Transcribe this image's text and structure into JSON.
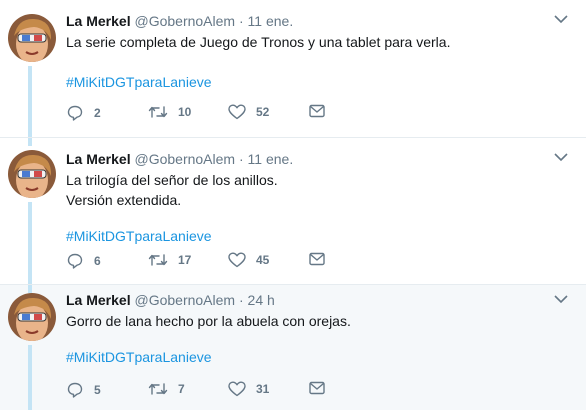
{
  "tweets": [
    {
      "name": "La Merkel",
      "handle": "@GobernoAlem",
      "separator": "·",
      "time": "11 ene.",
      "lines": [
        "La serie completa de Juego de Tronos y una tablet para verla."
      ],
      "hashtag": "#MiKitDGTparaLanieve",
      "replies": "2",
      "retweets": "10",
      "likes": "52"
    },
    {
      "name": "La Merkel",
      "handle": "@GobernoAlem",
      "separator": "·",
      "time": "11 ene.",
      "lines": [
        "La trilogía del señor de los anillos.",
        "Versión extendida."
      ],
      "hashtag": "#MiKitDGTparaLanieve",
      "replies": "6",
      "retweets": "17",
      "likes": "45"
    },
    {
      "name": "La Merkel",
      "handle": "@GobernoAlem",
      "separator": "·",
      "time": "24 h",
      "lines": [
        "Gorro de lana hecho por la abuela con orejas."
      ],
      "hashtag": "#MiKitDGTparaLanieve",
      "replies": "5",
      "retweets": "7",
      "likes": "31"
    }
  ],
  "icons": {
    "reply": "reply-icon",
    "retweet": "retweet-icon",
    "like": "heart-icon",
    "dm": "envelope-icon",
    "menu": "chevron-down-icon"
  },
  "colors": {
    "hashtag": "#1b95e0",
    "thread_line": "#c4e4f5",
    "muted": "#657786",
    "highlight_bg": "#f5f8fa"
  }
}
